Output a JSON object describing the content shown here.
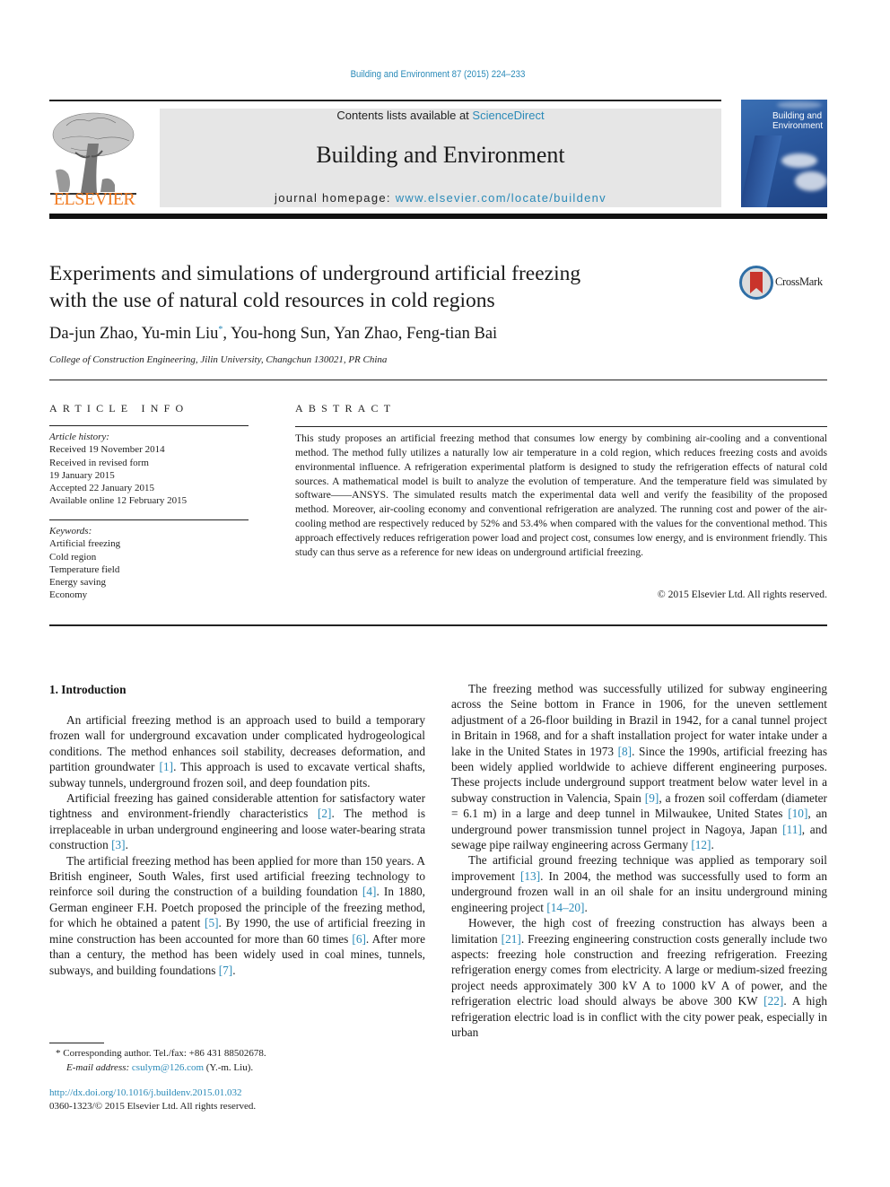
{
  "journal_citation": "Building and Environment 87 (2015) 224–233",
  "masthead": {
    "contents_prefix": "Contents lists available at ",
    "contents_link": "ScienceDirect",
    "journal_title": "Building and Environment",
    "homepage_prefix": "journal homepage: ",
    "homepage_link": "www.elsevier.com/locate/buildenv",
    "publisher_logo_text": "ELSEVIER",
    "cover_title_line1": "Building and",
    "cover_title_line2": "Environment",
    "publisher_color": "#f07b21",
    "link_color": "#2a8ab8"
  },
  "article": {
    "title_line1": "Experiments and simulations of underground artificial freezing",
    "title_line2": "with the use of natural cold resources in cold regions",
    "crossmark_label": "CrossMark",
    "authors_part1": "Da-jun Zhao, Yu-min Liu",
    "corresponding_marker": "*",
    "authors_part2": ", You-hong Sun, Yan Zhao, Feng-tian Bai",
    "affiliation": "College of Construction Engineering, Jilin University, Changchun 130021, PR China"
  },
  "article_info": {
    "heading": "ARTICLE INFO",
    "history_label": "Article history:",
    "history": [
      "Received 19 November 2014",
      "Received in revised form",
      "19 January 2015",
      "Accepted 22 January 2015",
      "Available online 12 February 2015"
    ],
    "keywords_label": "Keywords:",
    "keywords": [
      "Artificial freezing",
      "Cold region",
      "Temperature field",
      "Energy saving",
      "Economy"
    ]
  },
  "abstract": {
    "heading": "ABSTRACT",
    "text": "This study proposes an artificial freezing method that consumes low energy by combining air-cooling and a conventional method. The method fully utilizes a naturally low air temperature in a cold region, which reduces freezing costs and avoids environmental influence. A refrigeration experimental platform is designed to study the refrigeration effects of natural cold sources. A mathematical model is built to analyze the evolution of temperature. And the temperature field was simulated by software——ANSYS. The simulated results match the experimental data well and verify the feasibility of the proposed method. Moreover, air-cooling economy and conventional refrigeration are analyzed. The running cost and power of the air-cooling method are respectively reduced by 52% and 53.4% when compared with the values for the conventional method. This approach effectively reduces refrigeration power load and project cost, consumes low energy, and is environment friendly. This study can thus serve as a reference for new ideas on underground artificial freezing.",
    "copyright": "© 2015 Elsevier Ltd. All rights reserved."
  },
  "body": {
    "section_title": "1.  Introduction",
    "left_paragraphs": [
      [
        {
          "t": "An artificial freezing method is an approach used to build a temporary frozen wall for underground excavation under compli­cated hydrogeological conditions. The method enhances soil sta­bility, decreases deformation, and partition groundwater "
        },
        {
          "r": "[1]"
        },
        {
          "t": ". This approach is used to excavate vertical shafts, subway tunnels, un­derground frozen soil, and deep foundation pits."
        }
      ],
      [
        {
          "t": "Artificial freezing has gained considerable attention for satis­factory water tightness and environment-friendly characteristics "
        },
        {
          "r": "[2]"
        },
        {
          "t": ". The method is irreplaceable in urban underground engineering and loose water-bearing strata construction "
        },
        {
          "r": "[3]"
        },
        {
          "t": "."
        }
      ],
      [
        {
          "t": "The artificial freezing method has been applied for more than 150 years. A British engineer, South Wales, first used artificial freezing technology to reinforce soil during the construction of a building foundation "
        },
        {
          "r": "[4]"
        },
        {
          "t": ". In 1880, German engineer F.H. Poetch proposed the principle of the freezing method, for which he ob­tained a patent "
        },
        {
          "r": "[5]"
        },
        {
          "t": ". By 1990, the use of artificial freezing in mine construction has been accounted for more than 60 times "
        },
        {
          "r": "[6]"
        },
        {
          "t": ". After more than a century, the method has been widely used in coal mines, tunnels, subways, and building foundations "
        },
        {
          "r": "[7]"
        },
        {
          "t": "."
        }
      ]
    ],
    "right_paragraphs": [
      [
        {
          "t": "The freezing method was successfully utilized for subway en­gineering across the Seine bottom in France in 1906, for the uneven settlement adjustment of a 26-floor building in Brazil in 1942, for a canal tunnel project in Britain in 1968, and for a shaft installation project for water intake under a lake in the United States in 1973 "
        },
        {
          "r": "[8]"
        },
        {
          "t": ". Since the 1990s, artificial freezing has been widely applied worldwide to achieve different engineering purposes. These pro­jects include underground support treatment below water level in a subway construction in Valencia, Spain "
        },
        {
          "r": "[9]"
        },
        {
          "t": ", a frozen soil cofferdam (diameter = 6.1 m) in a large and deep tunnel in Milwaukee, United States "
        },
        {
          "r": "[10]"
        },
        {
          "t": ", an underground power transmission tunnel project in Nagoya, Japan "
        },
        {
          "r": "[11]"
        },
        {
          "t": ", and sewage pipe railway engineering across Germany "
        },
        {
          "r": "[12]"
        },
        {
          "t": "."
        }
      ],
      [
        {
          "t": "The artificial ground freezing technique was applied as tempo­rary soil improvement "
        },
        {
          "r": "[13]"
        },
        {
          "t": ". In 2004, the method was successfully used to form an underground frozen wall in an oil shale for an in­situ underground mining engineering project "
        },
        {
          "r": "[14–20]"
        },
        {
          "t": "."
        }
      ],
      [
        {
          "t": "However, the high cost of freezing construction has always been a limitation "
        },
        {
          "r": "[21]"
        },
        {
          "t": ". Freezing engineering construction costs generally include two aspects: freezing hole construction and freezing refrigeration. Freezing refrigeration energy comes from electricity. A large or medium-sized freezing project needs approximately 300 kV A to 1000 kV A of power, and the refrigeration electric load should always be above 300 KW "
        },
        {
          "r": "[22]"
        },
        {
          "t": ". A high refrigeration electric load is in conflict with the city power peak, especially in urban"
        }
      ]
    ]
  },
  "footnote": {
    "marker": "*",
    "corresponding": "Corresponding author. Tel./fax: +86 431 88502678.",
    "email_label": "E-mail address:",
    "email": "csulym@126.com",
    "email_suffix": " (Y.-m. Liu)."
  },
  "doi": {
    "link": "http://dx.doi.org/10.1016/j.buildenv.2015.01.032",
    "issn_line": "0360-1323/© 2015 Elsevier Ltd. All rights reserved."
  }
}
